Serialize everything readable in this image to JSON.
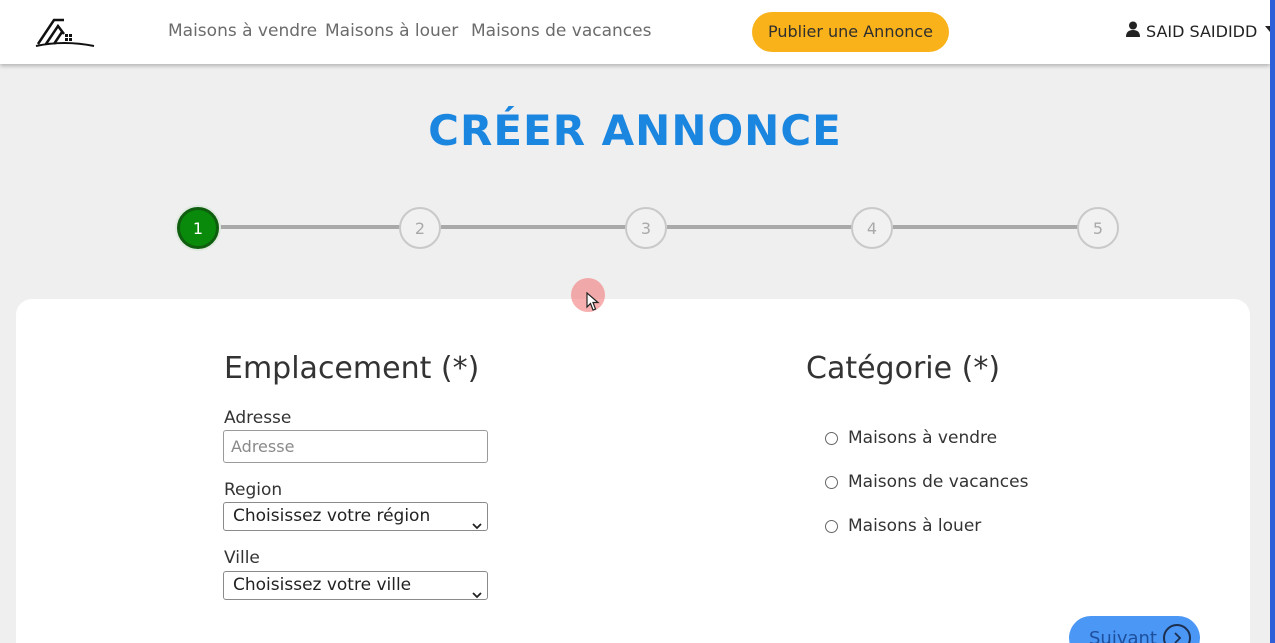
{
  "navbar": {
    "logo_icon": "house-roof-logo",
    "links": [
      "Maisons à vendre",
      "Maisons à louer",
      "Maisons de vacances"
    ],
    "publish_label": "Publier une Annonce",
    "user_icon": "user-icon",
    "user_name": "SAID SAIDIDD"
  },
  "page": {
    "title": "CRÉER ANNONCE"
  },
  "stepper": {
    "steps": [
      "1",
      "2",
      "3",
      "4",
      "5"
    ],
    "active_step": 1,
    "active_color": "#0a8a0a"
  },
  "location": {
    "title": "Emplacement (*)",
    "address_label": "Adresse",
    "address_placeholder": "Adresse",
    "address_value": "",
    "region_label": "Region",
    "region_selected": "Choisissez votre région",
    "city_label": "Ville",
    "city_selected": "Choisissez votre ville"
  },
  "category": {
    "title": "Catégorie (*)",
    "options": [
      "Maisons à vendre",
      "Maisons de vacances",
      "Maisons à louer"
    ]
  },
  "actions": {
    "next_label": "Suivant",
    "next_icon": "chevron-right-icon"
  },
  "colors": {
    "accent_blue": "#1a86e0",
    "publish_yellow": "#f9b21a",
    "next_blue": "#4b97f5"
  }
}
